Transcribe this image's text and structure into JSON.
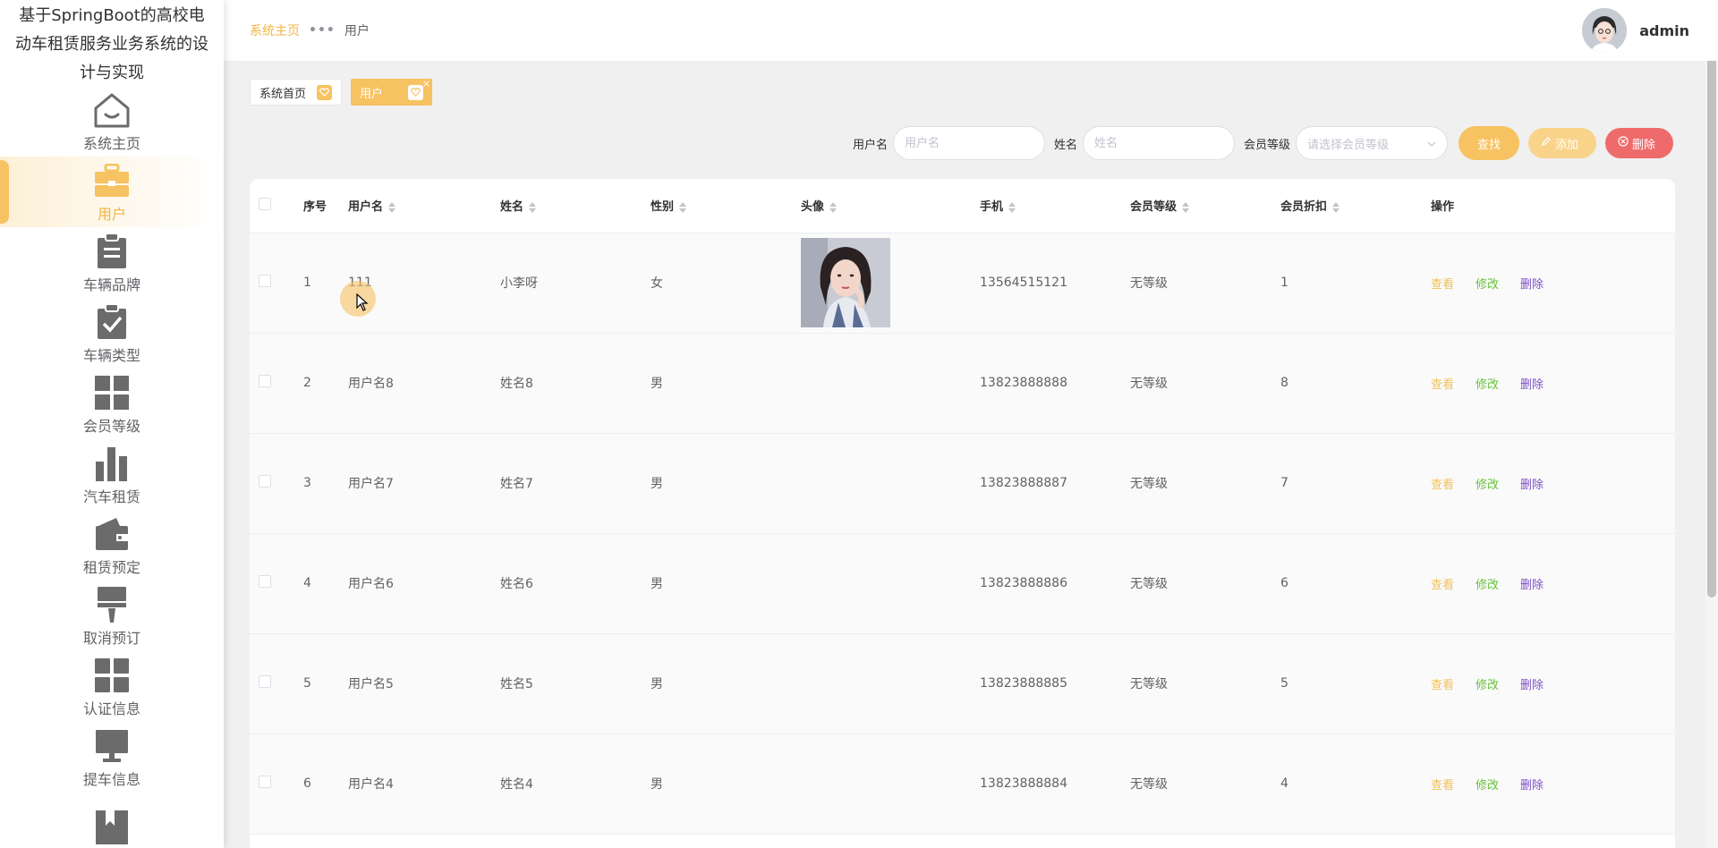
{
  "app": {
    "title": "基于SpringBoot的高校电动车租赁服务业务系统的设计与实现"
  },
  "sidebar": {
    "items": [
      {
        "label": "系统主页",
        "icon": "home-icon"
      },
      {
        "label": "用户",
        "icon": "briefcase-icon",
        "active": true
      },
      {
        "label": "车辆品牌",
        "icon": "clipboard-icon"
      },
      {
        "label": "车辆类型",
        "icon": "clipboard-check-icon"
      },
      {
        "label": "会员等级",
        "icon": "grid-icon"
      },
      {
        "label": "汽车租赁",
        "icon": "bar-chart-icon"
      },
      {
        "label": "租赁预定",
        "icon": "wallet-icon"
      },
      {
        "label": "取消预订",
        "icon": "brush-icon"
      },
      {
        "label": "认证信息",
        "icon": "apps-icon"
      },
      {
        "label": "提车信息",
        "icon": "monitor-icon"
      },
      {
        "label": "",
        "icon": "book-icon"
      }
    ]
  },
  "header": {
    "breadcrumb_home": "系统主页",
    "breadcrumb_sep": "•••",
    "breadcrumb_current": "用户",
    "username": "admin"
  },
  "tags": [
    {
      "label": "系统首页",
      "active": false
    },
    {
      "label": "用户",
      "active": true,
      "close": "×"
    }
  ],
  "search": {
    "username_label": "用户名",
    "username_placeholder": "用户名",
    "name_label": "姓名",
    "name_placeholder": "姓名",
    "level_label": "会员等级",
    "level_placeholder": "请选择会员等级",
    "find_button": "查找",
    "add_button": "添加",
    "delete_button": "删除"
  },
  "table": {
    "columns": [
      "序号",
      "用户名",
      "姓名",
      "性别",
      "头像",
      "手机",
      "会员等级",
      "会员折扣",
      "操作"
    ],
    "actions": {
      "view": "查看",
      "edit": "修改",
      "delete": "删除"
    },
    "rows": [
      {
        "index": "1",
        "username": "111",
        "name": "小李呀",
        "gender": "女",
        "has_photo": true,
        "phone": "13564515121",
        "level": "无等级",
        "discount": "1"
      },
      {
        "index": "2",
        "username": "用户名8",
        "name": "姓名8",
        "gender": "男",
        "has_photo": false,
        "phone": "13823888888",
        "level": "无等级",
        "discount": "8"
      },
      {
        "index": "3",
        "username": "用户名7",
        "name": "姓名7",
        "gender": "男",
        "has_photo": false,
        "phone": "13823888887",
        "level": "无等级",
        "discount": "7"
      },
      {
        "index": "4",
        "username": "用户名6",
        "name": "姓名6",
        "gender": "男",
        "has_photo": false,
        "phone": "13823888886",
        "level": "无等级",
        "discount": "6"
      },
      {
        "index": "5",
        "username": "用户名5",
        "name": "姓名5",
        "gender": "男",
        "has_photo": false,
        "phone": "13823888885",
        "level": "无等级",
        "discount": "5"
      },
      {
        "index": "6",
        "username": "用户名4",
        "name": "姓名4",
        "gender": "男",
        "has_photo": false,
        "phone": "13823888884",
        "level": "无等级",
        "discount": "4"
      }
    ]
  },
  "colors": {
    "accent": "#f7c261",
    "danger": "#ef6b6b",
    "edit": "#67c23a",
    "delete_link": "#7a4fc7",
    "icon_gray": "#6b6b6b"
  }
}
